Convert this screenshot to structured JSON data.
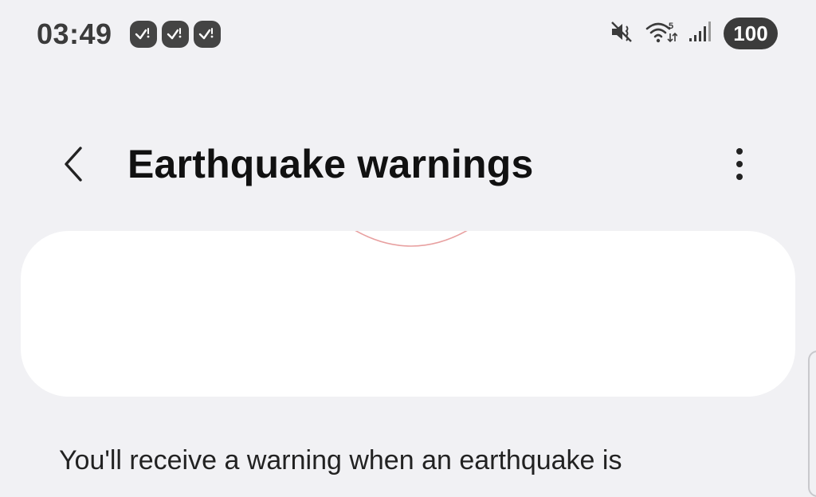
{
  "status_bar": {
    "time": "03:49",
    "notification_icons": [
      "check-question-badge-icon",
      "check-question-badge-icon",
      "check-question-badge-icon"
    ],
    "status_icons": [
      "vibrate-mute-icon",
      "wifi-5g-icon",
      "signal-bars-icon"
    ],
    "battery_level": "100"
  },
  "header": {
    "back_icon": "chevron-left-icon",
    "title": "Earthquake warnings",
    "more_icon": "more-vertical-icon"
  },
  "description": "You'll receive a warning when an earthquake is",
  "colors": {
    "background": "#f1f1f4",
    "card": "#ffffff",
    "arc_accent": "#e8a0a0",
    "status_dark": "#3b3b3b"
  }
}
